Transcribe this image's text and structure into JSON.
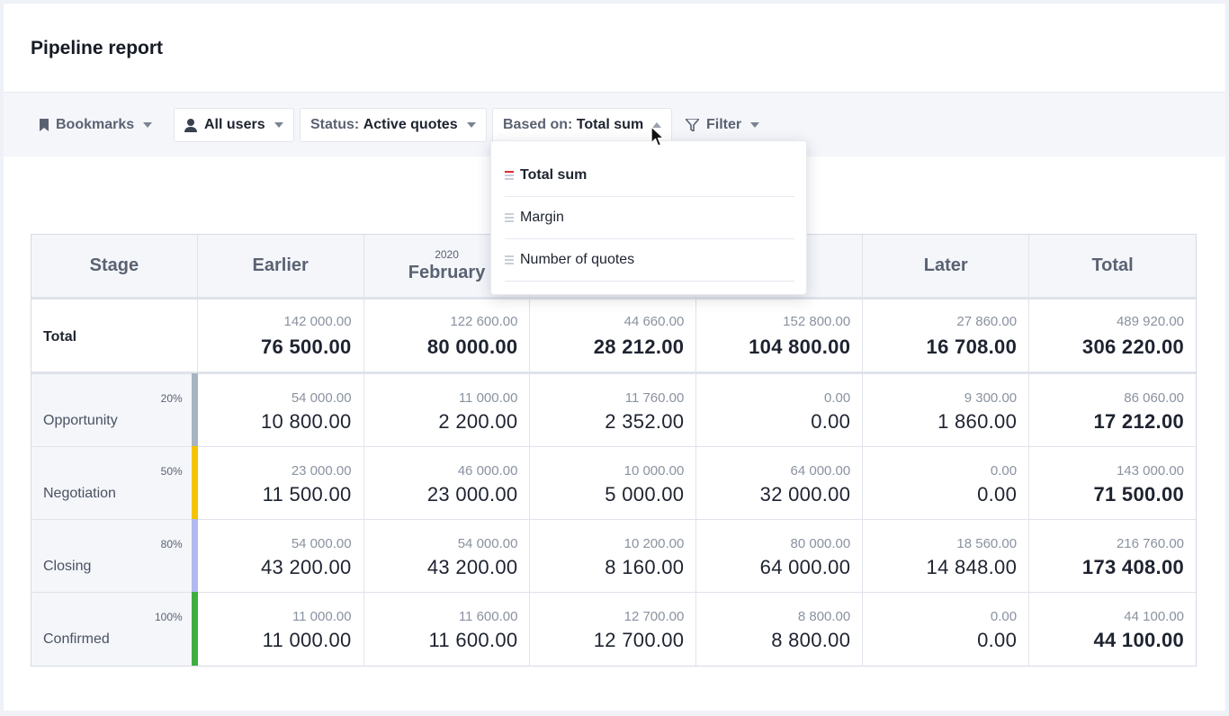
{
  "page": {
    "title": "Pipeline report"
  },
  "toolbar": {
    "bookmarks_label": "Bookmarks",
    "users_label": "All users",
    "status_prefix": "Status:",
    "status_value": "Active quotes",
    "based_prefix": "Based on:",
    "based_value": "Total sum",
    "filter_label": "Filter"
  },
  "dropdown": {
    "items": [
      {
        "label": "Total sum",
        "selected": true
      },
      {
        "label": "Margin",
        "selected": false
      },
      {
        "label": "Number of quotes",
        "selected": false
      }
    ]
  },
  "table": {
    "headers": {
      "stage": "Stage",
      "earlier": "Earlier",
      "feb_year": "2020",
      "feb_month": "February",
      "col3": "",
      "col4": "",
      "later": "Later",
      "total": "Total"
    },
    "total_row": {
      "label": "Total",
      "cells": [
        {
          "small": "142 000.00",
          "big": "76 500.00"
        },
        {
          "small": "122 600.00",
          "big": "80 000.00"
        },
        {
          "small": "44 660.00",
          "big": "28 212.00"
        },
        {
          "small": "152 800.00",
          "big": "104 800.00"
        },
        {
          "small": "27 860.00",
          "big": "16 708.00"
        },
        {
          "small": "489 920.00",
          "big": "306 220.00"
        }
      ]
    },
    "stages": [
      {
        "name": "Opportunity",
        "pct": "20%",
        "color": "#a9b4c2",
        "cells": [
          {
            "small": "54 000.00",
            "big": "10 800.00"
          },
          {
            "small": "11 000.00",
            "big": "2 200.00"
          },
          {
            "small": "11 760.00",
            "big": "2 352.00"
          },
          {
            "small": "0.00",
            "big": "0.00"
          },
          {
            "small": "9 300.00",
            "big": "1 860.00"
          },
          {
            "small": "86 060.00",
            "big": "17 212.00"
          }
        ]
      },
      {
        "name": "Negotiation",
        "pct": "50%",
        "color": "#f5c400",
        "cells": [
          {
            "small": "23 000.00",
            "big": "11 500.00"
          },
          {
            "small": "46 000.00",
            "big": "23 000.00"
          },
          {
            "small": "10 000.00",
            "big": "5 000.00"
          },
          {
            "small": "64 000.00",
            "big": "32 000.00"
          },
          {
            "small": "0.00",
            "big": "0.00"
          },
          {
            "small": "143 000.00",
            "big": "71 500.00"
          }
        ]
      },
      {
        "name": "Closing",
        "pct": "80%",
        "color": "#b3b8f0",
        "cells": [
          {
            "small": "54 000.00",
            "big": "43 200.00"
          },
          {
            "small": "54 000.00",
            "big": "43 200.00"
          },
          {
            "small": "10 200.00",
            "big": "8 160.00"
          },
          {
            "small": "80 000.00",
            "big": "64 000.00"
          },
          {
            "small": "18 560.00",
            "big": "14 848.00"
          },
          {
            "small": "216 760.00",
            "big": "173 408.00"
          }
        ]
      },
      {
        "name": "Confirmed",
        "pct": "100%",
        "color": "#3fae3f",
        "cells": [
          {
            "small": "11 000.00",
            "big": "11 000.00"
          },
          {
            "small": "11 600.00",
            "big": "11 600.00"
          },
          {
            "small": "12 700.00",
            "big": "12 700.00"
          },
          {
            "small": "8 800.00",
            "big": "8 800.00"
          },
          {
            "small": "0.00",
            "big": "0.00"
          },
          {
            "small": "44 100.00",
            "big": "44 100.00"
          }
        ]
      }
    ]
  }
}
